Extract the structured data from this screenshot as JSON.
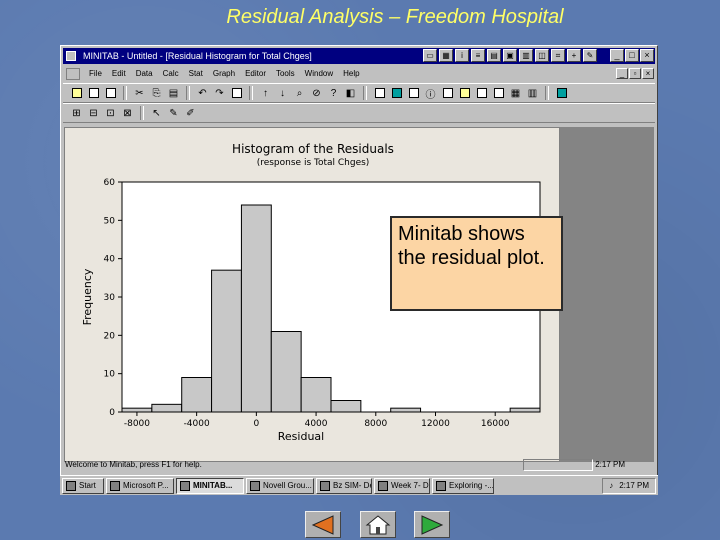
{
  "slide": {
    "title": "Residual Analysis – Freedom Hospital"
  },
  "window": {
    "title": "MINITAB - Untitled - [Residual Histogram for Total Chges]",
    "menu": [
      "File",
      "Edit",
      "Data",
      "Calc",
      "Stat",
      "Graph",
      "Editor",
      "Tools",
      "Window",
      "Help"
    ]
  },
  "chart_data": {
    "type": "bar",
    "title": "Histogram of the Residuals",
    "subtitle": "(response is Total Chges)",
    "xlabel": "Residual",
    "ylabel": "Frequency",
    "bin_width": 2000,
    "bins": [
      -8000,
      -6000,
      -4000,
      -2000,
      0,
      2000,
      4000,
      6000,
      8000,
      10000,
      12000,
      14000,
      16000,
      18000
    ],
    "values": [
      1,
      2,
      9,
      37,
      54,
      21,
      9,
      3,
      0,
      1,
      0,
      0,
      0,
      1
    ],
    "x_ticks": [
      "-8000",
      "-4000",
      "0",
      "4000",
      "8000",
      "12000",
      "16000"
    ],
    "y_ticks": [
      "0",
      "10",
      "20",
      "30",
      "40",
      "50",
      "60"
    ],
    "xlim": [
      -9000,
      19000
    ],
    "ylim": [
      0,
      60
    ],
    "bar_color": "#c8c8c8"
  },
  "callout": {
    "text": "Minitab shows the residual plot."
  },
  "status": {
    "message": "Welcome to Minitab, press F1 for help.",
    "time": "2:17 PM"
  },
  "taskbar": {
    "start": "Start",
    "tasks": [
      "Microsoft P...",
      "MINITAB...",
      "Novell Grou...",
      "Bz SIM- De...",
      "Week 7- Dev...",
      "Exploring -..."
    ],
    "active_index": 1,
    "time": "2:17 PM"
  }
}
